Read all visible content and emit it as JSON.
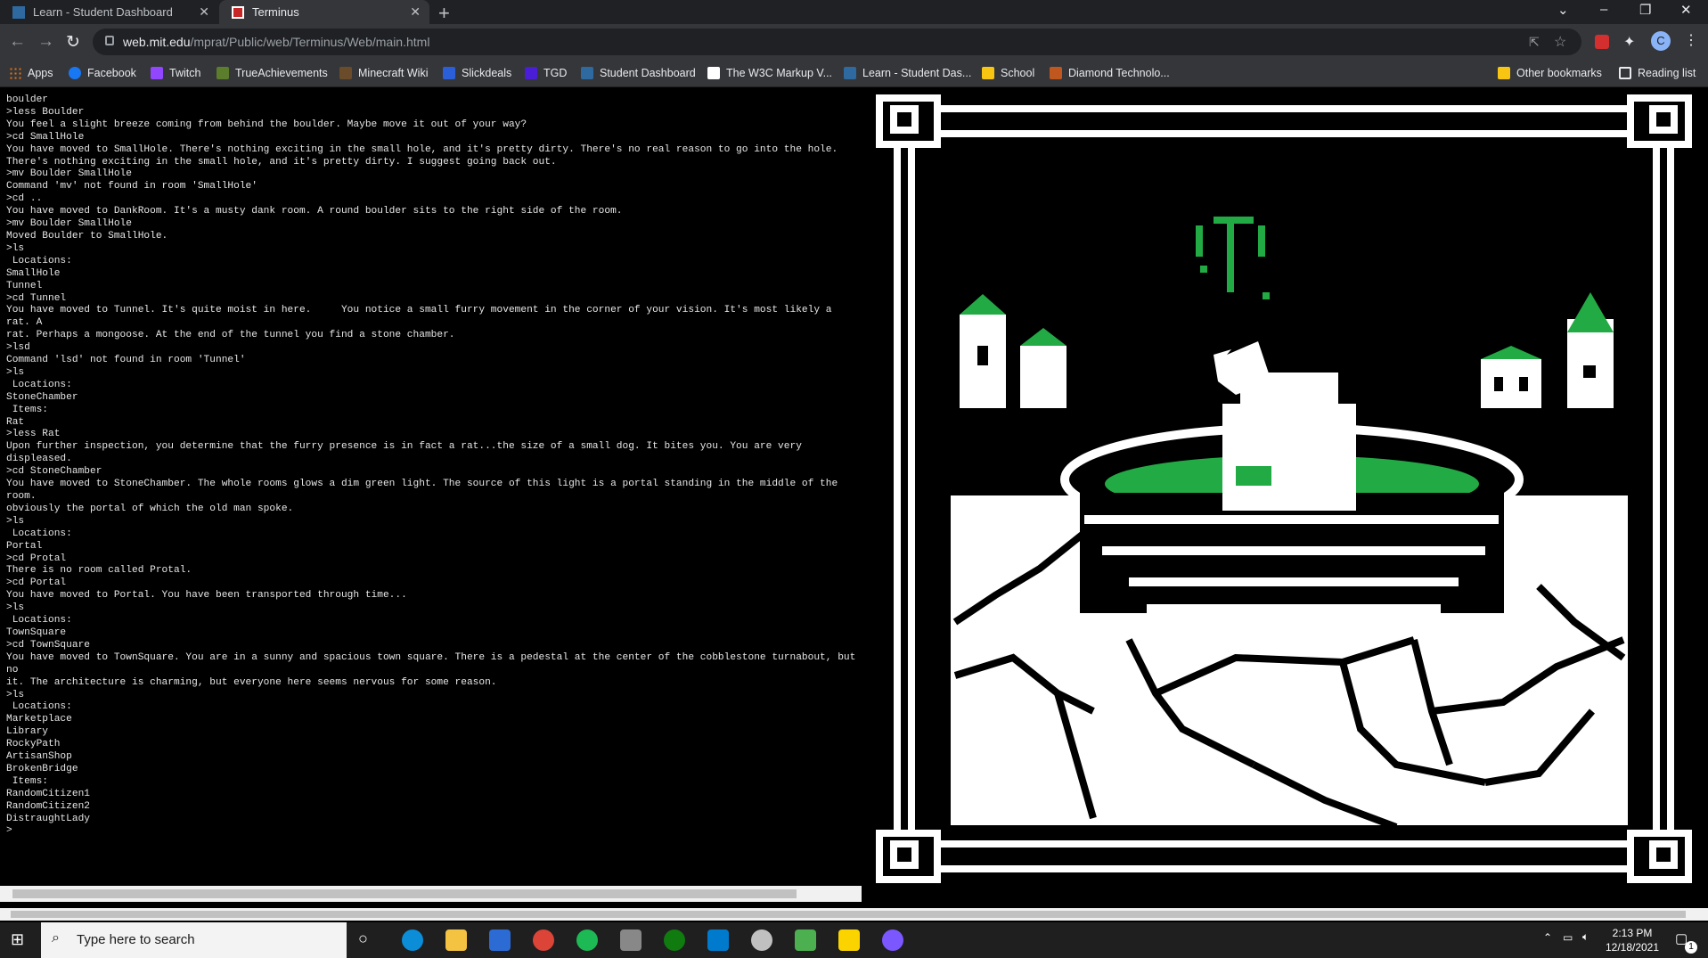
{
  "tabs": [
    {
      "label": "Learn - Student Dashboard",
      "active": false
    },
    {
      "label": "Terminus",
      "active": true
    }
  ],
  "address": {
    "host": "web.mit.edu",
    "path": "/mprat/Public/web/Terminus/Web/main.html"
  },
  "profile_initial": "C",
  "bookmarks": [
    {
      "label": "Apps",
      "color": "#e8710a"
    },
    {
      "label": "Facebook",
      "color": "#1877f2"
    },
    {
      "label": "Twitch",
      "color": "#9146ff"
    },
    {
      "label": "TrueAchievements",
      "color": "#5b7d2c"
    },
    {
      "label": "Minecraft Wiki",
      "color": "#6b4c2a"
    },
    {
      "label": "Slickdeals",
      "color": "#2b5fd9"
    },
    {
      "label": "TGD",
      "color": "#4a1dd6"
    },
    {
      "label": "Student Dashboard",
      "color": "#2e6aa0"
    },
    {
      "label": "The W3C Markup V...",
      "color": "#ffffff"
    },
    {
      "label": "Learn - Student Das...",
      "color": "#2e6aa0"
    },
    {
      "label": "School",
      "color": "#f9c513"
    },
    {
      "label": "Diamond Technolo...",
      "color": "#c0571f"
    }
  ],
  "bookmarks_right": {
    "other": "Other bookmarks",
    "reading": "Reading list"
  },
  "terminal_lines": [
    "boulder",
    ">less Boulder",
    "You feel a slight breeze coming from behind the boulder. Maybe move it out of your way?",
    ">cd SmallHole",
    "You have moved to SmallHole. There's nothing exciting in the small hole, and it's pretty dirty. There's no real reason to go into the hole.",
    "There's nothing exciting in the small hole, and it's pretty dirty. I suggest going back out.",
    ">mv Boulder SmallHole",
    "Command 'mv' not found in room 'SmallHole'",
    ">cd ..",
    "You have moved to DankRoom. It's a musty dank room. A round boulder sits to the right side of the room.",
    ">mv Boulder SmallHole",
    "Moved Boulder to SmallHole.",
    ">ls",
    " Locations:",
    "SmallHole",
    "Tunnel",
    ">cd Tunnel",
    "You have moved to Tunnel. It's quite moist in here.     You notice a small furry movement in the corner of your vision. It's most likely a rat. A",
    "rat. Perhaps a mongoose. At the end of the tunnel you find a stone chamber.",
    ">lsd",
    "Command 'lsd' not found in room 'Tunnel'",
    ">ls",
    " Locations:",
    "StoneChamber",
    " Items:",
    "Rat",
    ">less Rat",
    "Upon further inspection, you determine that the furry presence is in fact a rat...the size of a small dog. It bites you. You are very displeased.",
    ">cd StoneChamber",
    "You have moved to StoneChamber. The whole rooms glows a dim green light. The source of this light is a portal standing in the middle of the room.",
    "obviously the portal of which the old man spoke.",
    ">ls",
    " Locations:",
    "Portal",
    ">cd Protal",
    "There is no room called Protal.",
    ">cd Portal",
    "You have moved to Portal. You have been transported through time...",
    ">ls",
    " Locations:",
    "TownSquare",
    ">cd TownSquare",
    "You have moved to TownSquare. You are in a sunny and spacious town square. There is a pedestal at the center of the cobblestone turnabout, but no",
    "it. The architecture is charming, but everyone here seems nervous for some reason.",
    ">ls",
    " Locations:",
    "Marketplace",
    "Library",
    "RockyPath",
    "ArtisanShop",
    "BrokenBridge",
    " Items:",
    "RandomCitizen1",
    "RandomCitizen2",
    "DistraughtLady",
    ">"
  ],
  "art": {
    "ink": "#ffffff",
    "green": "#22aa44",
    "background": "#000000"
  },
  "taskbar": {
    "search_placeholder": "Type here to search",
    "time": "2:13 PM",
    "date": "12/18/2021",
    "notification_count": "1"
  }
}
